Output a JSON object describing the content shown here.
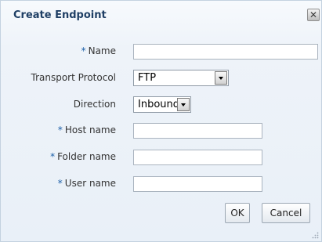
{
  "dialog": {
    "title": "Create Endpoint",
    "close_icon": "close-icon"
  },
  "form": {
    "name": {
      "label": "Name",
      "required_marker": "*",
      "value": ""
    },
    "transport_protocol": {
      "label": "Transport Protocol",
      "selected": "FTP"
    },
    "direction": {
      "label": "Direction",
      "selected": "Inbound"
    },
    "host_name": {
      "label": "Host name",
      "required_marker": "*",
      "value": ""
    },
    "folder_name": {
      "label": "Folder name",
      "required_marker": "*",
      "value": ""
    },
    "user_name": {
      "label": "User name",
      "required_marker": "*",
      "value": ""
    }
  },
  "buttons": {
    "ok": "OK",
    "cancel": "Cancel"
  },
  "colors": {
    "title_text": "#1f3f65",
    "required_marker": "#1b5fa8",
    "background": "#eef3f9"
  }
}
